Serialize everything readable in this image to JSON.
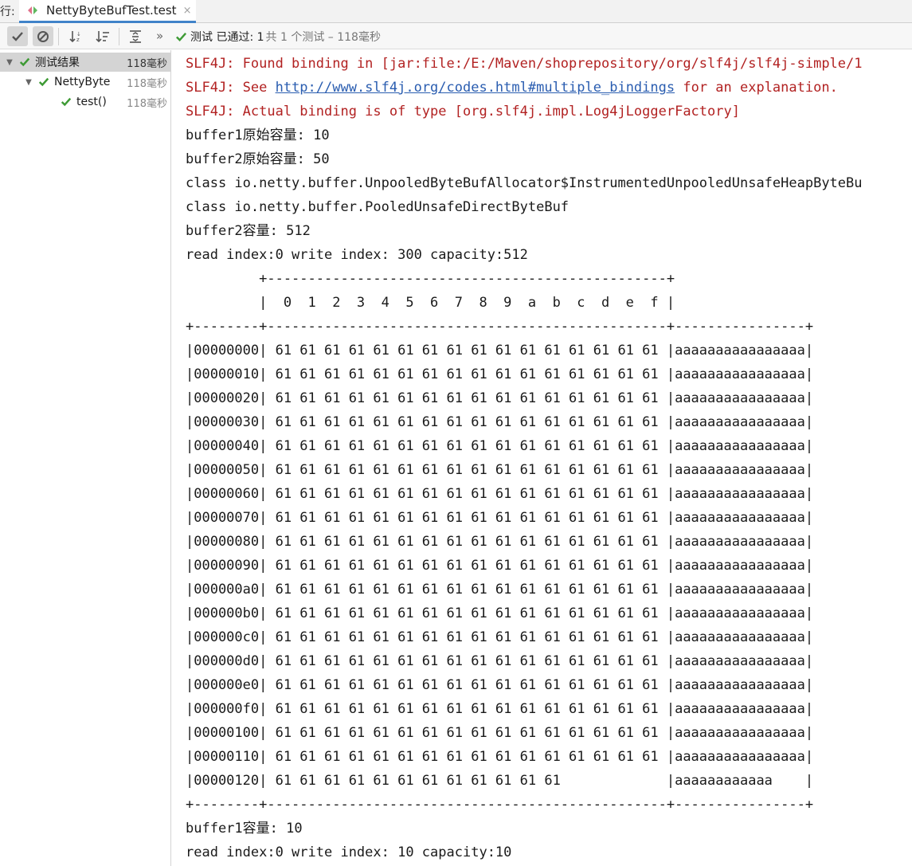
{
  "tabbar": {
    "run_label": "行:",
    "tab_title": "NettyByteBufTest.test",
    "close_glyph": "×"
  },
  "toolbar": {
    "status_main": "测试 已通过: 1",
    "status_detail": "共 1 个测试 – 118毫秒"
  },
  "tree": {
    "items": [
      {
        "label": "测试结果",
        "time": "118毫秒"
      },
      {
        "label": "NettyByte",
        "time": "118毫秒"
      },
      {
        "label": "test()",
        "time": "118毫秒"
      }
    ]
  },
  "colors": {
    "pass_green": "#3d9a34",
    "error_red": "#b22222",
    "link_blue": "#2a5db0",
    "selected_row": "#d4d4d4"
  },
  "console": {
    "slf4j_1": "SLF4J: Found binding in [jar:file:/E:/Maven/shoprepository/org/slf4j/slf4j-simple/1",
    "slf4j_2_prefix": "SLF4J: See ",
    "slf4j_2_link": "http://www.slf4j.org/codes.html#multiple_bindings",
    "slf4j_2_suffix": " for an explanation.",
    "slf4j_3": "SLF4J: Actual binding is of type [org.slf4j.impl.Log4jLoggerFactory]",
    "output": [
      "buffer1原始容量: 10",
      "buffer2原始容量: 50",
      "class io.netty.buffer.UnpooledByteBufAllocator$InstrumentedUnpooledUnsafeHeapByteBu",
      "class io.netty.buffer.PooledUnsafeDirectByteBuf",
      "buffer2容量: 512",
      "read index:0 write index: 300 capacity:512",
      "         +-------------------------------------------------+",
      "         |  0  1  2  3  4  5  6  7  8  9  a  b  c  d  e  f |",
      "+--------+-------------------------------------------------+----------------+",
      "|00000000| 61 61 61 61 61 61 61 61 61 61 61 61 61 61 61 61 |aaaaaaaaaaaaaaaa|",
      "|00000010| 61 61 61 61 61 61 61 61 61 61 61 61 61 61 61 61 |aaaaaaaaaaaaaaaa|",
      "|00000020| 61 61 61 61 61 61 61 61 61 61 61 61 61 61 61 61 |aaaaaaaaaaaaaaaa|",
      "|00000030| 61 61 61 61 61 61 61 61 61 61 61 61 61 61 61 61 |aaaaaaaaaaaaaaaa|",
      "|00000040| 61 61 61 61 61 61 61 61 61 61 61 61 61 61 61 61 |aaaaaaaaaaaaaaaa|",
      "|00000050| 61 61 61 61 61 61 61 61 61 61 61 61 61 61 61 61 |aaaaaaaaaaaaaaaa|",
      "|00000060| 61 61 61 61 61 61 61 61 61 61 61 61 61 61 61 61 |aaaaaaaaaaaaaaaa|",
      "|00000070| 61 61 61 61 61 61 61 61 61 61 61 61 61 61 61 61 |aaaaaaaaaaaaaaaa|",
      "|00000080| 61 61 61 61 61 61 61 61 61 61 61 61 61 61 61 61 |aaaaaaaaaaaaaaaa|",
      "|00000090| 61 61 61 61 61 61 61 61 61 61 61 61 61 61 61 61 |aaaaaaaaaaaaaaaa|",
      "|000000a0| 61 61 61 61 61 61 61 61 61 61 61 61 61 61 61 61 |aaaaaaaaaaaaaaaa|",
      "|000000b0| 61 61 61 61 61 61 61 61 61 61 61 61 61 61 61 61 |aaaaaaaaaaaaaaaa|",
      "|000000c0| 61 61 61 61 61 61 61 61 61 61 61 61 61 61 61 61 |aaaaaaaaaaaaaaaa|",
      "|000000d0| 61 61 61 61 61 61 61 61 61 61 61 61 61 61 61 61 |aaaaaaaaaaaaaaaa|",
      "|000000e0| 61 61 61 61 61 61 61 61 61 61 61 61 61 61 61 61 |aaaaaaaaaaaaaaaa|",
      "|000000f0| 61 61 61 61 61 61 61 61 61 61 61 61 61 61 61 61 |aaaaaaaaaaaaaaaa|",
      "|00000100| 61 61 61 61 61 61 61 61 61 61 61 61 61 61 61 61 |aaaaaaaaaaaaaaaa|",
      "|00000110| 61 61 61 61 61 61 61 61 61 61 61 61 61 61 61 61 |aaaaaaaaaaaaaaaa|",
      "|00000120| 61 61 61 61 61 61 61 61 61 61 61 61             |aaaaaaaaaaaa    |",
      "+--------+-------------------------------------------------+----------------+",
      "buffer1容量: 10",
      "read index:0 write index: 10 capacity:10"
    ]
  }
}
